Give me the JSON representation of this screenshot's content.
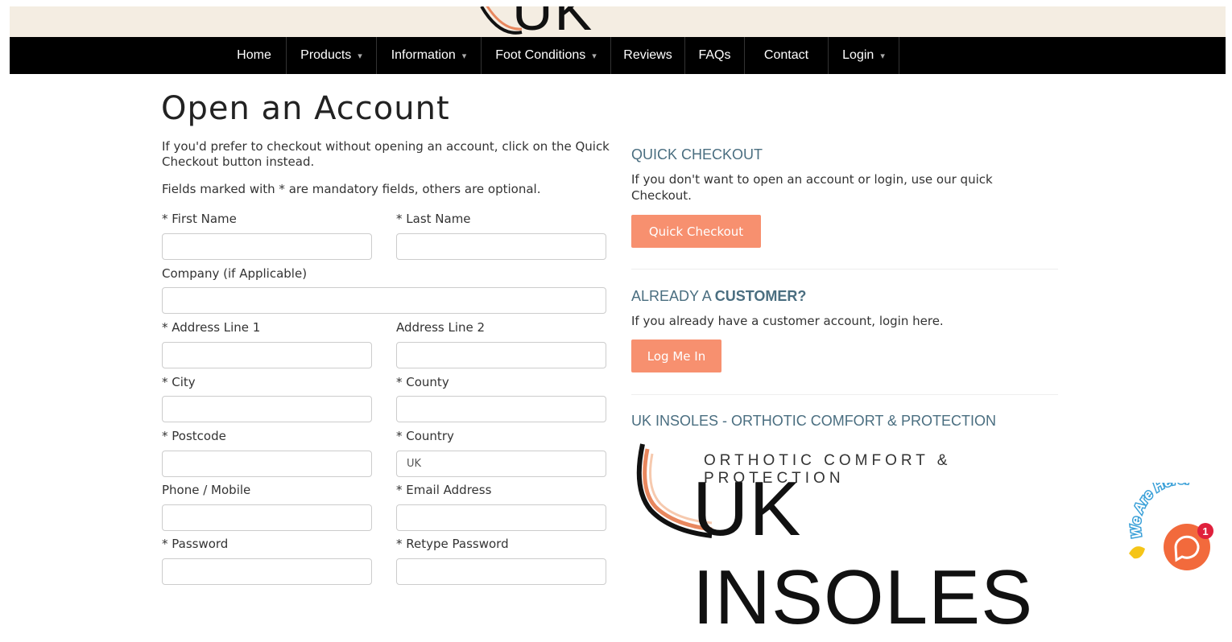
{
  "brand": {
    "logo_text": "UK INSOLES",
    "tagline": "ORTHOTIC COMFORT & PROTECTION"
  },
  "nav": [
    {
      "label": "Home",
      "dropdown": false
    },
    {
      "label": "Products",
      "dropdown": true
    },
    {
      "label": "Information",
      "dropdown": true
    },
    {
      "label": "Foot Conditions",
      "dropdown": true
    },
    {
      "label": "Reviews",
      "dropdown": false
    },
    {
      "label": "FAQs",
      "dropdown": false
    },
    {
      "label": "Contact",
      "dropdown": false
    },
    {
      "label": "Login",
      "dropdown": true
    }
  ],
  "page": {
    "title": "Open an Account",
    "intro": "If you'd prefer to checkout without opening an account, click on the Quick Checkout button instead.",
    "mandatory_note": "Fields marked with * are mandatory fields, others are optional."
  },
  "form": {
    "first_name": {
      "label": "* First Name",
      "value": ""
    },
    "last_name": {
      "label": "* Last Name",
      "value": ""
    },
    "company": {
      "label": "Company (if Applicable)",
      "value": ""
    },
    "address1": {
      "label": "* Address Line 1",
      "value": ""
    },
    "address2": {
      "label": "Address Line 2",
      "value": ""
    },
    "city": {
      "label": "* City",
      "value": ""
    },
    "county": {
      "label": "* County",
      "value": ""
    },
    "postcode": {
      "label": "* Postcode",
      "value": ""
    },
    "country": {
      "label": "* Country",
      "value": "UK"
    },
    "phone": {
      "label": "Phone / Mobile",
      "value": ""
    },
    "email": {
      "label": "* Email Address",
      "value": ""
    },
    "password": {
      "label": "* Password",
      "value": ""
    },
    "retype_password": {
      "label": "* Retype Password",
      "value": ""
    }
  },
  "sidebar": {
    "quick": {
      "heading": "QUICK CHECKOUT",
      "text": "If you don't want to open an account or login, use our quick Checkout.",
      "button": "Quick Checkout"
    },
    "customer": {
      "heading_prefix": "ALREADY A ",
      "heading_bold": "CUSTOMER?",
      "text": "If you already have a customer account, login here.",
      "button": "Log Me In"
    },
    "brand_heading": "UK INSOLES - ORTHOTIC COMFORT & PROTECTION"
  },
  "chat": {
    "bubble_text": "We Are Here!",
    "badge_count": "1"
  },
  "colors": {
    "accent": "#f7906f",
    "heading": "#4a6e80",
    "nav_bg": "#000000",
    "header_bg": "#f4ede2",
    "chat": "#f26a3c"
  }
}
